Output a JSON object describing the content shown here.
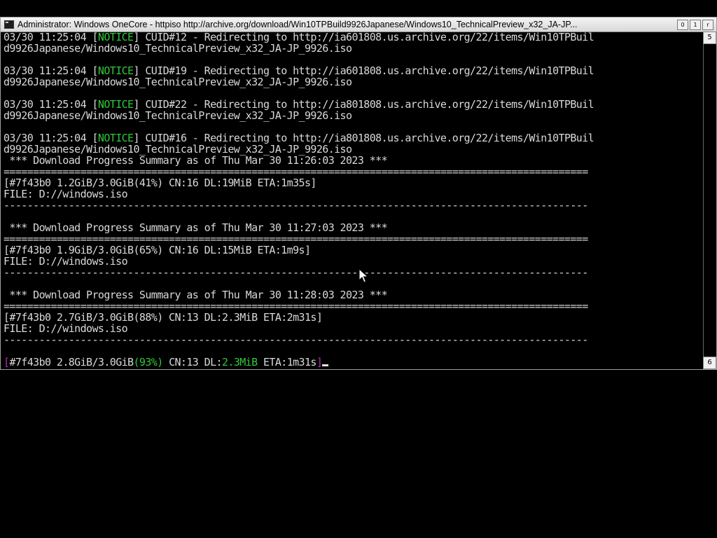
{
  "window": {
    "title": "Administrator:  Windows OneCore - httpiso  http://archive.org/download/Win10TPBuild9926Japanese/Windows10_TechnicalPreview_x32_JA-JP...",
    "buttons": [
      "0",
      "1",
      "r"
    ]
  },
  "scroll": {
    "up": "5",
    "down": "6"
  },
  "console": {
    "lines": [
      {
        "p": [
          {
            "t": "03/30 11:25:04 ["
          },
          {
            "t": "NOTICE",
            "c": "g"
          },
          {
            "t": "] CUID#12 - Redirecting to http://ia601808.us.archive.org/22/items/Win10TPBuil"
          }
        ]
      },
      {
        "p": [
          {
            "t": "d9926Japanese/Windows10_TechnicalPreview_x32_JA-JP_9926.iso"
          }
        ]
      },
      {
        "p": [
          {
            "t": ""
          }
        ]
      },
      {
        "p": [
          {
            "t": "03/30 11:25:04 ["
          },
          {
            "t": "NOTICE",
            "c": "g"
          },
          {
            "t": "] CUID#19 - Redirecting to http://ia601808.us.archive.org/22/items/Win10TPBuil"
          }
        ]
      },
      {
        "p": [
          {
            "t": "d9926Japanese/Windows10_TechnicalPreview_x32_JA-JP_9926.iso"
          }
        ]
      },
      {
        "p": [
          {
            "t": ""
          }
        ]
      },
      {
        "p": [
          {
            "t": "03/30 11:25:04 ["
          },
          {
            "t": "NOTICE",
            "c": "g"
          },
          {
            "t": "] CUID#22 - Redirecting to http://ia801808.us.archive.org/22/items/Win10TPBuil"
          }
        ]
      },
      {
        "p": [
          {
            "t": "d9926Japanese/Windows10_TechnicalPreview_x32_JA-JP_9926.iso"
          }
        ]
      },
      {
        "p": [
          {
            "t": ""
          }
        ]
      },
      {
        "p": [
          {
            "t": "03/30 11:25:04 ["
          },
          {
            "t": "NOTICE",
            "c": "g"
          },
          {
            "t": "] CUID#16 - Redirecting to http://ia801808.us.archive.org/22/items/Win10TPBuil"
          }
        ]
      },
      {
        "p": [
          {
            "t": "d9926Japanese/Windows10_TechnicalPreview_x32_JA-JP_9926.iso"
          }
        ]
      },
      {
        "p": [
          {
            "t": " *** Download Progress Summary as of Thu Mar 30 11:26:03 2023 ***"
          }
        ]
      },
      {
        "p": [
          {
            "t": "==================================================================================================="
          }
        ]
      },
      {
        "p": [
          {
            "t": "[#7f43b0 1.2GiB/3.0GiB(41%) CN:16 DL:19MiB ETA:1m35s]"
          }
        ]
      },
      {
        "p": [
          {
            "t": "FILE: D://windows.iso"
          }
        ]
      },
      {
        "p": [
          {
            "t": "---------------------------------------------------------------------------------------------------"
          }
        ]
      },
      {
        "p": [
          {
            "t": ""
          }
        ]
      },
      {
        "p": [
          {
            "t": " *** Download Progress Summary as of Thu Mar 30 11:27:03 2023 ***"
          }
        ]
      },
      {
        "p": [
          {
            "t": "==================================================================================================="
          }
        ]
      },
      {
        "p": [
          {
            "t": "[#7f43b0 1.9GiB/3.0GiB(65%) CN:16 DL:15MiB ETA:1m9s]"
          }
        ]
      },
      {
        "p": [
          {
            "t": "FILE: D://windows.iso"
          }
        ]
      },
      {
        "p": [
          {
            "t": "---------------------------------------------------------------------------------------------------"
          }
        ]
      },
      {
        "p": [
          {
            "t": ""
          }
        ]
      },
      {
        "p": [
          {
            "t": " *** Download Progress Summary as of Thu Mar 30 11:28:03 2023 ***"
          }
        ]
      },
      {
        "p": [
          {
            "t": "==================================================================================================="
          }
        ]
      },
      {
        "p": [
          {
            "t": "[#7f43b0 2.7GiB/3.0GiB(88%) CN:13 DL:2.3MiB ETA:2m31s]"
          }
        ]
      },
      {
        "p": [
          {
            "t": "FILE: D://windows.iso"
          }
        ]
      },
      {
        "p": [
          {
            "t": "---------------------------------------------------------------------------------------------------"
          }
        ]
      },
      {
        "p": [
          {
            "t": ""
          }
        ]
      },
      {
        "p": [
          {
            "t": "[",
            "c": "m"
          },
          {
            "t": "#7f43b0 2.8GiB/3.0GiB"
          },
          {
            "t": "(93%)",
            "c": "g"
          },
          {
            "t": " CN:13 DL:"
          },
          {
            "t": "2.3MiB",
            "c": "g"
          },
          {
            "t": " ETA:1m31s"
          },
          {
            "t": "]",
            "c": "m"
          }
        ],
        "cursor": true
      }
    ]
  },
  "colors": {
    "background": "#000000",
    "text": "#d9d9d9",
    "notice_green": "#2fc93a",
    "bracket_magenta": "#b82ab0"
  }
}
